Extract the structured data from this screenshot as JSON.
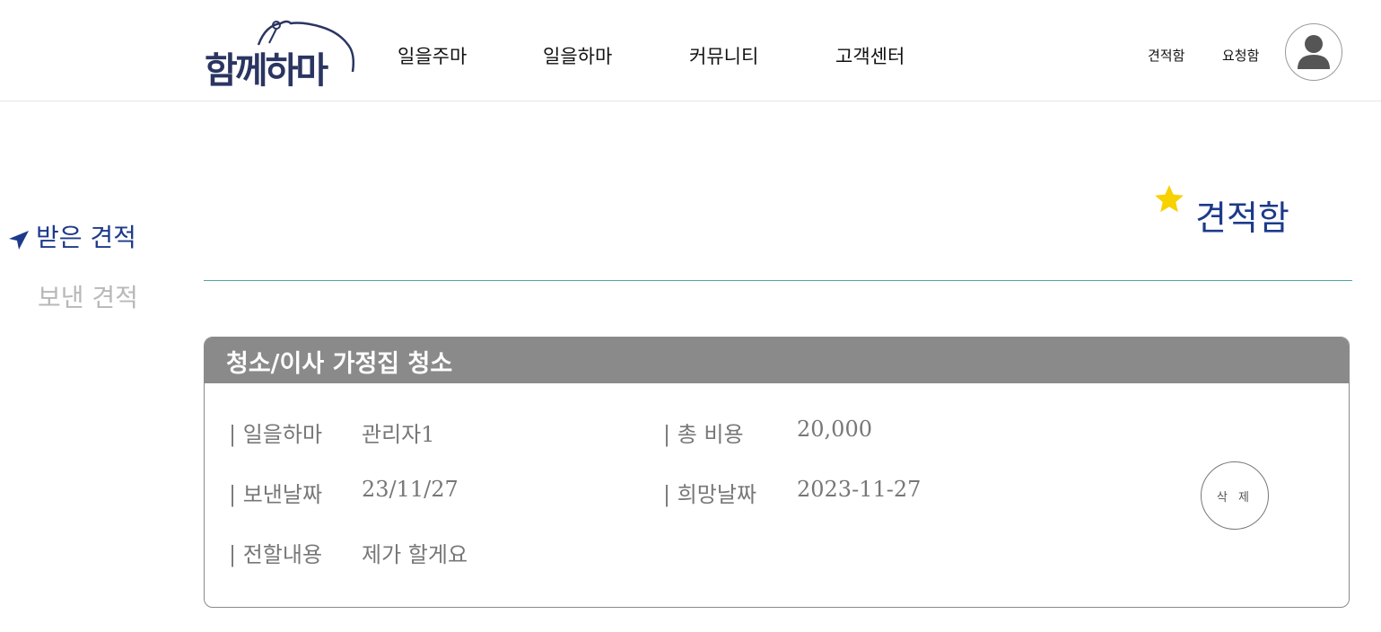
{
  "header": {
    "logo_text": "함께하마",
    "nav": [
      "일을주마",
      "일을하마",
      "커뮤니티",
      "고객센터"
    ],
    "links": {
      "quote_box": "견적함",
      "request_box": "요청함"
    }
  },
  "sidebar": {
    "items": [
      {
        "label": "받은 견적",
        "active": true
      },
      {
        "label": "보낸 견적",
        "active": false
      }
    ]
  },
  "page": {
    "title": "견적함"
  },
  "card": {
    "title": "청소/이사 가정집 청소",
    "fields": {
      "worker_label": "| 일을하마",
      "worker_value": "관리자1",
      "total_label": "| 총 비용",
      "total_value": "20,000",
      "sent_label": "| 보낸날짜",
      "sent_value": "23/11/27",
      "wish_label": "| 희망날짜",
      "wish_value": "2023-11-27",
      "message_label": "| 전할내용",
      "message_value": "제가 할게요"
    },
    "delete_label": "삭 제"
  },
  "colors": {
    "brand": "#1d3a8a",
    "logo": "#2b3561",
    "card_header": "#8a8a8a",
    "divider": "#4aa8a0",
    "star": "#f7d100"
  }
}
